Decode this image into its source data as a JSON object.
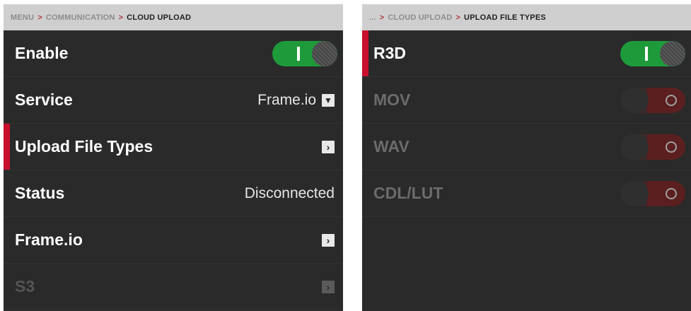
{
  "left": {
    "breadcrumb": {
      "part1": "MENU",
      "sep1": ">",
      "part2": "COMMUNICATION",
      "sep2": ">",
      "current": "CLOUD UPLOAD"
    },
    "rows": {
      "enable": {
        "label": "Enable",
        "state": "on"
      },
      "service": {
        "label": "Service",
        "value": "Frame.io",
        "icon": "dropdown-arrow"
      },
      "upload_file_types": {
        "label": "Upload File Types",
        "icon": "chevron-right",
        "selected": true
      },
      "status": {
        "label": "Status",
        "value": "Disconnected"
      },
      "frameio": {
        "label": "Frame.io",
        "icon": "chevron-right"
      },
      "s3": {
        "label": "S3",
        "icon": "chevron-right",
        "disabled": true
      }
    }
  },
  "right": {
    "breadcrumb": {
      "part1": "...",
      "sep1": ">",
      "part2": "CLOUD UPLOAD",
      "sep2": ">",
      "current": "UPLOAD FILE TYPES"
    },
    "rows": {
      "r3d": {
        "label": "R3D",
        "state": "on",
        "selected": true
      },
      "mov": {
        "label": "MOV",
        "state": "off"
      },
      "wav": {
        "label": "WAV",
        "state": "off"
      },
      "cdl_lut": {
        "label": "CDL/LUT",
        "state": "off"
      }
    }
  },
  "glyphs": {
    "dropdown": "▼",
    "chevron": "›"
  },
  "colors": {
    "accent_red": "#c8102e",
    "toggle_on": "#1e9a3a",
    "toggle_off": "#5c1f1f",
    "panel_bg": "#2a2a2a",
    "crumb_bg": "#cfcfcf"
  }
}
